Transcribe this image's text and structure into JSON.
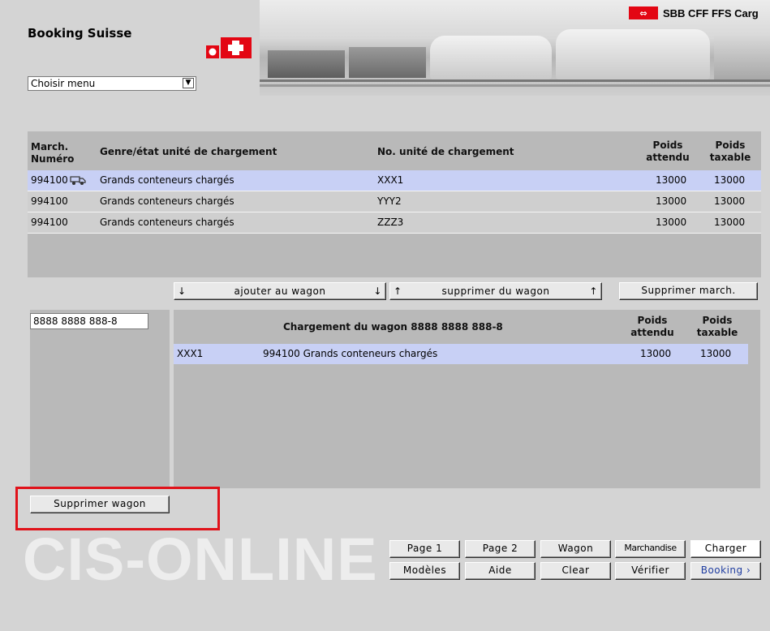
{
  "app": {
    "title": "Booking Suisse",
    "brand": "SBB CFF FFS Carg",
    "watermark": "CIS-ONLINE"
  },
  "menu": {
    "selected": "Choisir menu"
  },
  "top_table": {
    "headers": {
      "march_line1": "March.",
      "march_line2": "Numéro",
      "genre": "Genre/état unité de chargement",
      "no_unite": "No. unité de chargement",
      "poids_att_line1": "Poids",
      "poids_att_line2": "attendu",
      "poids_tax_line1": "Poids",
      "poids_tax_line2": "taxable"
    },
    "rows": [
      {
        "march": "994100",
        "genre": "Grands conteneurs chargés",
        "no": "XXX1",
        "attendu": "13000",
        "taxable": "13000"
      },
      {
        "march": "994100",
        "genre": "Grands conteneurs chargés",
        "no": "YYY2",
        "attendu": "13000",
        "taxable": "13000"
      },
      {
        "march": "994100",
        "genre": "Grands conteneurs chargés",
        "no": "ZZZ3",
        "attendu": "13000",
        "taxable": "13000"
      }
    ]
  },
  "actions": {
    "add_to_wagon": "ajouter au wagon",
    "remove_from_wagon": "supprimer du wagon",
    "delete_march": "Supprimer march."
  },
  "wagon": {
    "number": "8888 8888 888-8",
    "load_title": "Chargement du wagon 8888 8888 888-8",
    "headers": {
      "poids_att_line1": "Poids",
      "poids_att_line2": "attendu",
      "poids_tax_line1": "Poids",
      "poids_tax_line2": "taxable"
    },
    "rows": [
      {
        "no": "XXX1",
        "desc": "994100 Grands conteneurs chargés",
        "attendu": "13000",
        "taxable": "13000"
      }
    ],
    "delete_wagon": "Supprimer wagon"
  },
  "nav": {
    "page1": "Page 1",
    "page2": "Page 2",
    "wagon": "Wagon",
    "marchandise": "Marchandise",
    "charger": "Charger",
    "modeles": "Modèles",
    "aide": "Aide",
    "clear": "Clear",
    "verifier": "Vérifier",
    "booking": "Booking ›"
  },
  "colors": {
    "background": "#d4d4d4",
    "panel": "#b9b9b9",
    "selected_row": "#c8d0f5",
    "highlight": "#e0121a",
    "sbb_red": "#e30613"
  }
}
